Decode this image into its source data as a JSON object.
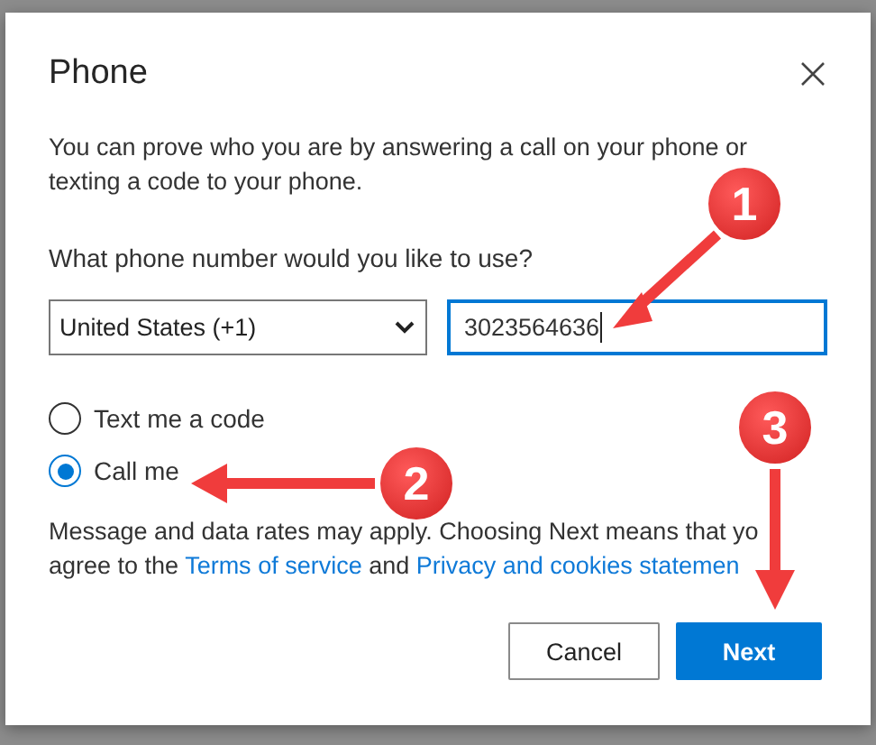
{
  "dialog": {
    "title": "Phone",
    "intro": "You can prove who you are by answering a call on your phone or texting a code to your phone.",
    "question": "What phone number would you like to use?",
    "country": {
      "value": "United States (+1)"
    },
    "phone": {
      "value": "3023564636",
      "focused": true
    },
    "options": [
      {
        "label": "Text me a code",
        "selected": false
      },
      {
        "label": "Call me",
        "selected": true
      }
    ],
    "notice": {
      "line_1": "Message and data rates may apply. Choosing Next means that yo",
      "line_2": "agree to the",
      "links": [
        "Terms of service",
        "Privacy and cookies statemen"
      ],
      "joiner": "and"
    },
    "buttons": [
      {
        "label": "Cancel",
        "kind": "secondary"
      },
      {
        "label": "Next",
        "kind": "primary"
      }
    ]
  },
  "annotations": [
    {
      "label": "1"
    },
    {
      "label": "2"
    },
    {
      "label": "3"
    }
  ]
}
